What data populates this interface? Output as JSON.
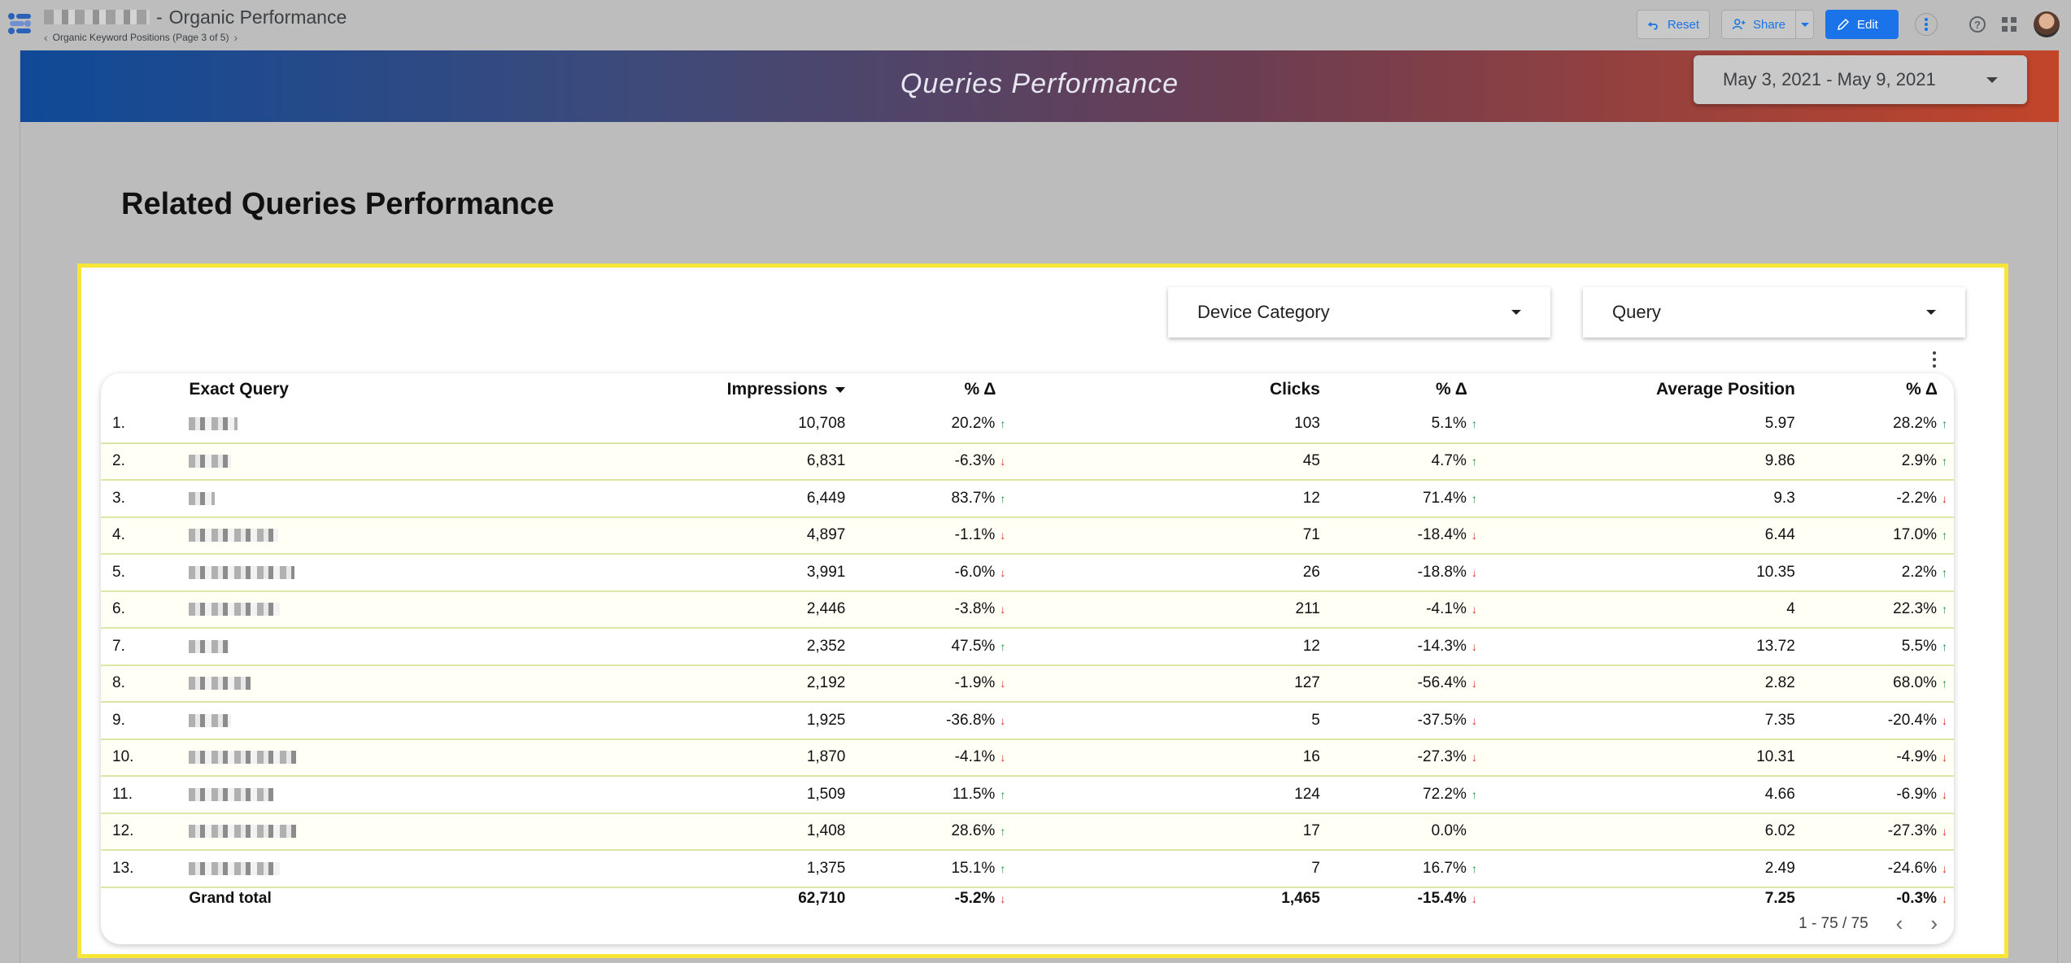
{
  "header": {
    "report_title": "Organic Performance",
    "page_label": "Organic Keyword Positions (Page 3 of 5)",
    "reset_label": "Reset",
    "share_label": "Share",
    "edit_label": "Edit"
  },
  "banner": {
    "title": "Queries Performance",
    "date_range": "May 3, 2021 - May 9, 2021"
  },
  "section": {
    "title": "Related Queries Performance"
  },
  "filters": {
    "device_category": "Device Category",
    "query": "Query"
  },
  "table": {
    "columns": {
      "query": "Exact Query",
      "impressions": "Impressions",
      "impressions_delta": "% Δ",
      "clicks": "Clicks",
      "clicks_delta": "% Δ",
      "avg_position": "Average Position",
      "position_delta": "% Δ"
    },
    "rows": [
      {
        "idx": "1.",
        "impressions": "10,708",
        "imp_delta": "20.2%",
        "imp_dir": "up",
        "clicks": "103",
        "clk_delta": "5.1%",
        "clk_dir": "up",
        "position": "5.97",
        "pos_delta": "28.2%",
        "pos_dir": "up"
      },
      {
        "idx": "2.",
        "impressions": "6,831",
        "imp_delta": "-6.3%",
        "imp_dir": "down",
        "clicks": "45",
        "clk_delta": "4.7%",
        "clk_dir": "up",
        "position": "9.86",
        "pos_delta": "2.9%",
        "pos_dir": "up"
      },
      {
        "idx": "3.",
        "impressions": "6,449",
        "imp_delta": "83.7%",
        "imp_dir": "up",
        "clicks": "12",
        "clk_delta": "71.4%",
        "clk_dir": "up",
        "position": "9.3",
        "pos_delta": "-2.2%",
        "pos_dir": "down"
      },
      {
        "idx": "4.",
        "impressions": "4,897",
        "imp_delta": "-1.1%",
        "imp_dir": "down",
        "clicks": "71",
        "clk_delta": "-18.4%",
        "clk_dir": "down",
        "position": "6.44",
        "pos_delta": "17.0%",
        "pos_dir": "up"
      },
      {
        "idx": "5.",
        "impressions": "3,991",
        "imp_delta": "-6.0%",
        "imp_dir": "down",
        "clicks": "26",
        "clk_delta": "-18.8%",
        "clk_dir": "down",
        "position": "10.35",
        "pos_delta": "2.2%",
        "pos_dir": "up"
      },
      {
        "idx": "6.",
        "impressions": "2,446",
        "imp_delta": "-3.8%",
        "imp_dir": "down",
        "clicks": "211",
        "clk_delta": "-4.1%",
        "clk_dir": "down",
        "position": "4",
        "pos_delta": "22.3%",
        "pos_dir": "up"
      },
      {
        "idx": "7.",
        "impressions": "2,352",
        "imp_delta": "47.5%",
        "imp_dir": "up",
        "clicks": "12",
        "clk_delta": "-14.3%",
        "clk_dir": "down",
        "position": "13.72",
        "pos_delta": "5.5%",
        "pos_dir": "up"
      },
      {
        "idx": "8.",
        "impressions": "2,192",
        "imp_delta": "-1.9%",
        "imp_dir": "down",
        "clicks": "127",
        "clk_delta": "-56.4%",
        "clk_dir": "down",
        "position": "2.82",
        "pos_delta": "68.0%",
        "pos_dir": "up"
      },
      {
        "idx": "9.",
        "impressions": "1,925",
        "imp_delta": "-36.8%",
        "imp_dir": "down",
        "clicks": "5",
        "clk_delta": "-37.5%",
        "clk_dir": "down",
        "position": "7.35",
        "pos_delta": "-20.4%",
        "pos_dir": "down"
      },
      {
        "idx": "10.",
        "impressions": "1,870",
        "imp_delta": "-4.1%",
        "imp_dir": "down",
        "clicks": "16",
        "clk_delta": "-27.3%",
        "clk_dir": "down",
        "position": "10.31",
        "pos_delta": "-4.9%",
        "pos_dir": "down"
      },
      {
        "idx": "11.",
        "impressions": "1,509",
        "imp_delta": "11.5%",
        "imp_dir": "up",
        "clicks": "124",
        "clk_delta": "72.2%",
        "clk_dir": "up",
        "position": "4.66",
        "pos_delta": "-6.9%",
        "pos_dir": "down"
      },
      {
        "idx": "12.",
        "impressions": "1,408",
        "imp_delta": "28.6%",
        "imp_dir": "up",
        "clicks": "17",
        "clk_delta": "0.0%",
        "clk_dir": "none",
        "position": "6.02",
        "pos_delta": "-27.3%",
        "pos_dir": "down"
      },
      {
        "idx": "13.",
        "impressions": "1,375",
        "imp_delta": "15.1%",
        "imp_dir": "up",
        "clicks": "7",
        "clk_delta": "16.7%",
        "clk_dir": "up",
        "position": "2.49",
        "pos_delta": "-24.6%",
        "pos_dir": "down"
      }
    ],
    "total": {
      "label": "Grand total",
      "impressions": "62,710",
      "imp_delta": "-5.2%",
      "imp_dir": "down",
      "clicks": "1,465",
      "clk_delta": "-15.4%",
      "clk_dir": "down",
      "position": "7.25",
      "pos_delta": "-0.3%",
      "pos_dir": "down"
    },
    "pagination": "1 - 75 / 75"
  },
  "icons": {
    "up": "↑",
    "down": "↓",
    "prev": "‹",
    "next": "›",
    "nav_prev": "‹",
    "nav_next": "›",
    "help": "?"
  },
  "colors": {
    "up": "#1e8e3e",
    "down": "#d93025",
    "highlight": "#f7e53a",
    "edit": "#1a73e8"
  }
}
